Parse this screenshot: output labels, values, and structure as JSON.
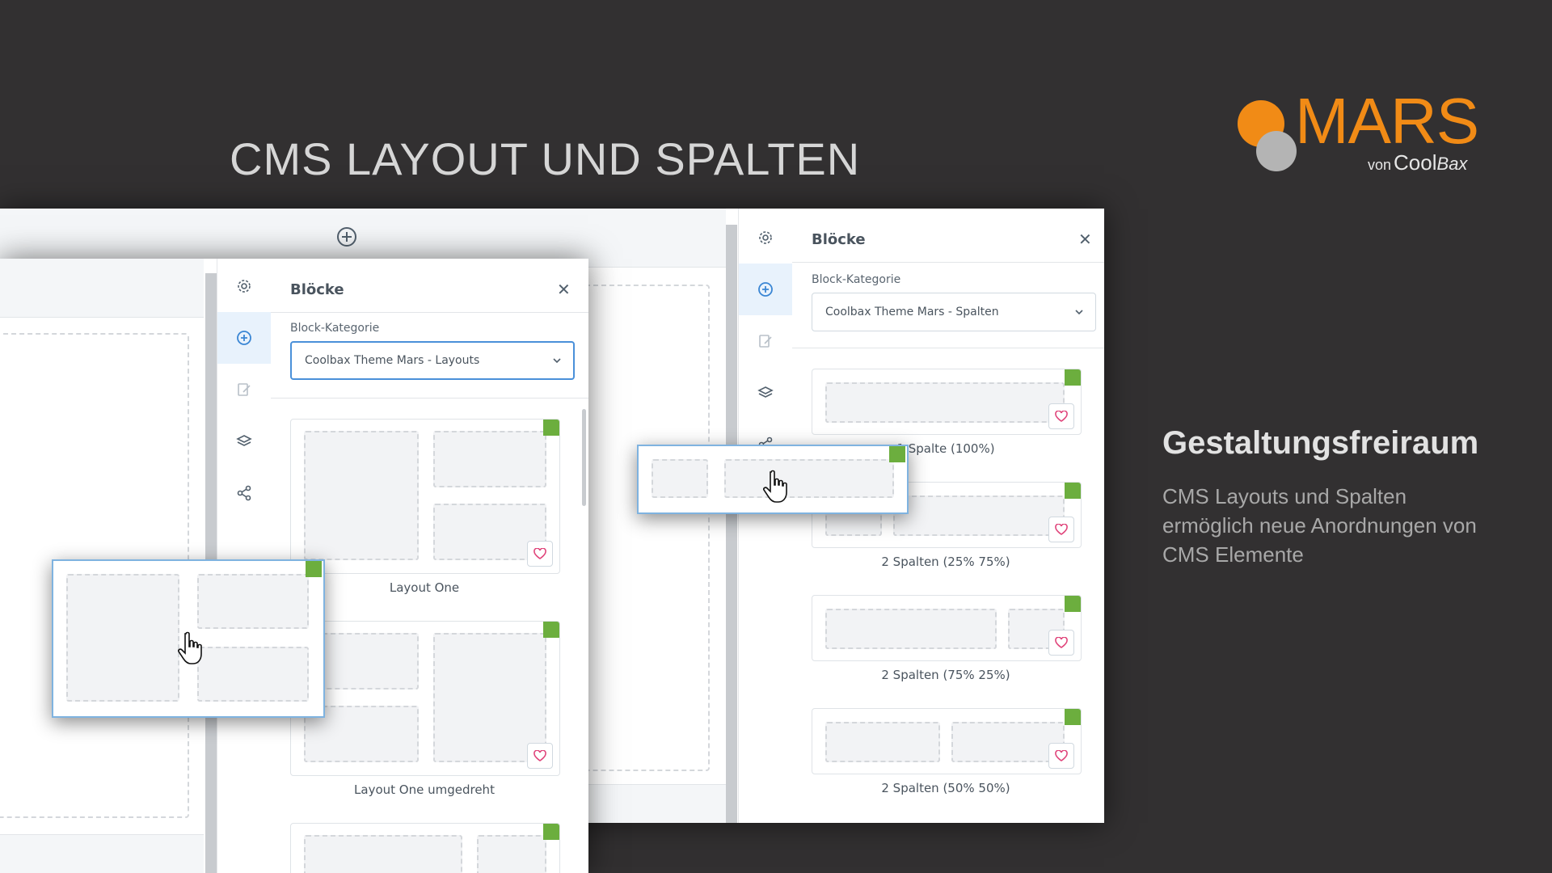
{
  "headline": "CMS LAYOUT UND SPALTEN",
  "logo": {
    "brand": "MARS",
    "von": "von",
    "cool": "Cool",
    "bax": "Bax"
  },
  "side": {
    "heading": "Gestaltungsfreiraum",
    "text": "CMS Layouts und Spalten ermöglich neue Anordnungen von CMS Elemente"
  },
  "window_back": {
    "panel_title": "Blöcke",
    "category_label": "Block-Kategorie",
    "category_value": "Coolbax Theme Mars - Spalten",
    "blocks": [
      {
        "label": "1 Spalte (100%)"
      },
      {
        "label": "2 Spalten (25% 75%)"
      },
      {
        "label": "2 Spalten (75% 25%)"
      },
      {
        "label": "2 Spalten (50% 50%)"
      }
    ]
  },
  "window_front": {
    "panel_title": "Blöcke",
    "category_label": "Block-Kategorie",
    "category_value": "Coolbax Theme Mars - Layouts",
    "blocks": [
      {
        "label": "Layout One"
      },
      {
        "label": "Layout One umgedreht"
      },
      {
        "label": ""
      }
    ]
  },
  "icons": {
    "sidebar": [
      "gear-icon",
      "plus-circle-icon",
      "edit-icon",
      "layers-icon",
      "share-icon"
    ],
    "favorite": "heart-icon",
    "cursor": "hand-cursor-icon",
    "close": "close-icon"
  },
  "colors": {
    "background": "#323031",
    "brand_orange": "#f18b16",
    "logo_gray": "#b4b4b4",
    "accent_blue": "#4a90d9",
    "tag_green": "#6cae3e",
    "heart_pink": "#e0457b"
  }
}
